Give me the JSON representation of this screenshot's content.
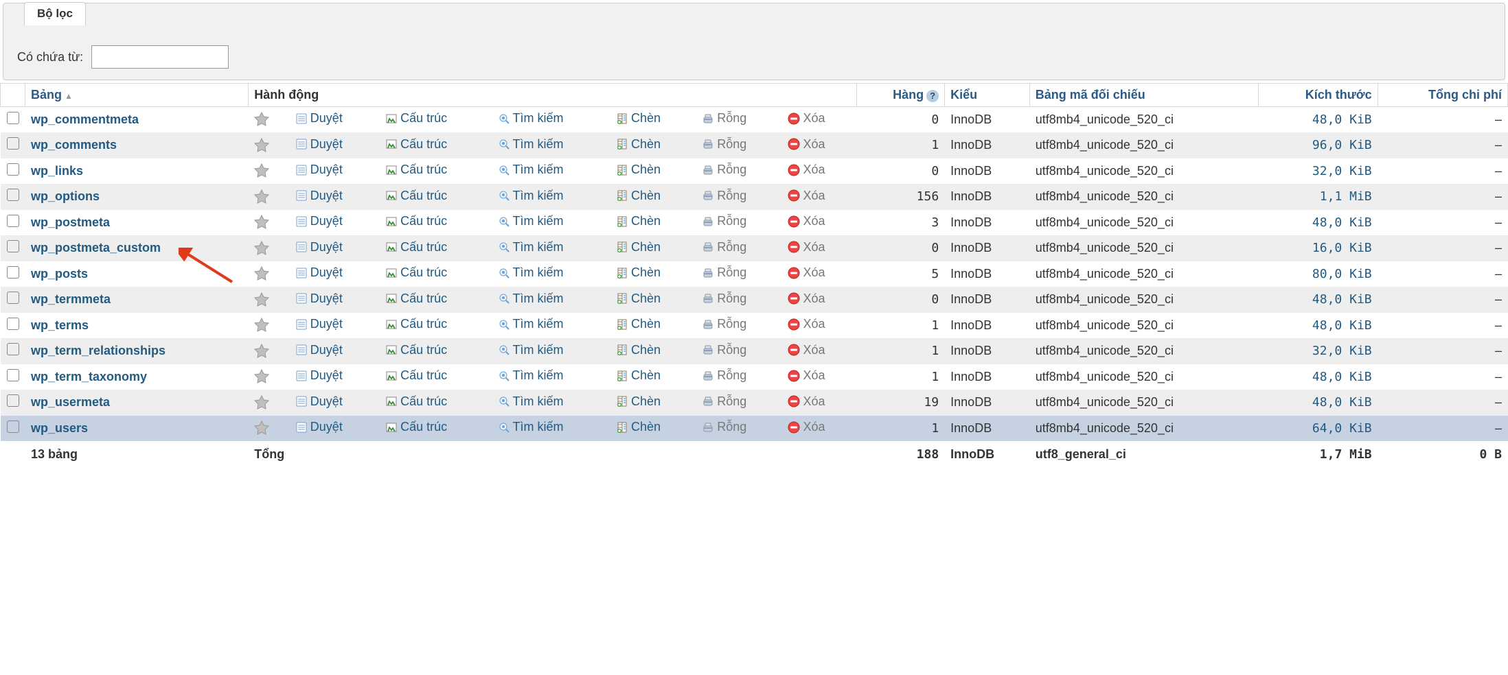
{
  "filter": {
    "tab_label": "Bộ lọc",
    "label": "Có chứa từ:",
    "value": ""
  },
  "columns": {
    "table": "Bảng",
    "action": "Hành động",
    "rows": "Hàng",
    "type": "Kiểu",
    "collation": "Bảng mã đối chiếu",
    "size": "Kích thước",
    "overhead": "Tổng chi phí"
  },
  "action_labels": {
    "browse": "Duyệt",
    "structure": "Cấu trúc",
    "search": "Tìm kiếm",
    "insert": "Chèn",
    "empty": "Rỗng",
    "drop": "Xóa"
  },
  "tables": [
    {
      "name": "wp_commentmeta",
      "rows": "0",
      "type": "InnoDB",
      "collation": "utf8mb4_unicode_520_ci",
      "size": "48,0 KiB",
      "overhead": "–"
    },
    {
      "name": "wp_comments",
      "rows": "1",
      "type": "InnoDB",
      "collation": "utf8mb4_unicode_520_ci",
      "size": "96,0 KiB",
      "overhead": "–"
    },
    {
      "name": "wp_links",
      "rows": "0",
      "type": "InnoDB",
      "collation": "utf8mb4_unicode_520_ci",
      "size": "32,0 KiB",
      "overhead": "–"
    },
    {
      "name": "wp_options",
      "rows": "156",
      "type": "InnoDB",
      "collation": "utf8mb4_unicode_520_ci",
      "size": "1,1 MiB",
      "overhead": "–"
    },
    {
      "name": "wp_postmeta",
      "rows": "3",
      "type": "InnoDB",
      "collation": "utf8mb4_unicode_520_ci",
      "size": "48,0 KiB",
      "overhead": "–"
    },
    {
      "name": "wp_postmeta_custom",
      "rows": "0",
      "type": "InnoDB",
      "collation": "utf8mb4_unicode_520_ci",
      "size": "16,0 KiB",
      "overhead": "–"
    },
    {
      "name": "wp_posts",
      "rows": "5",
      "type": "InnoDB",
      "collation": "utf8mb4_unicode_520_ci",
      "size": "80,0 KiB",
      "overhead": "–"
    },
    {
      "name": "wp_termmeta",
      "rows": "0",
      "type": "InnoDB",
      "collation": "utf8mb4_unicode_520_ci",
      "size": "48,0 KiB",
      "overhead": "–"
    },
    {
      "name": "wp_terms",
      "rows": "1",
      "type": "InnoDB",
      "collation": "utf8mb4_unicode_520_ci",
      "size": "48,0 KiB",
      "overhead": "–"
    },
    {
      "name": "wp_term_relationships",
      "rows": "1",
      "type": "InnoDB",
      "collation": "utf8mb4_unicode_520_ci",
      "size": "32,0 KiB",
      "overhead": "–"
    },
    {
      "name": "wp_term_taxonomy",
      "rows": "1",
      "type": "InnoDB",
      "collation": "utf8mb4_unicode_520_ci",
      "size": "48,0 KiB",
      "overhead": "–"
    },
    {
      "name": "wp_usermeta",
      "rows": "19",
      "type": "InnoDB",
      "collation": "utf8mb4_unicode_520_ci",
      "size": "48,0 KiB",
      "overhead": "–"
    },
    {
      "name": "wp_users",
      "rows": "1",
      "type": "InnoDB",
      "collation": "utf8mb4_unicode_520_ci",
      "size": "64,0 KiB",
      "overhead": "–",
      "hover": true
    }
  ],
  "summary": {
    "count_label": "13 bảng",
    "total_label": "Tổng",
    "rows": "188",
    "type": "InnoDB",
    "collation": "utf8_general_ci",
    "size": "1,7 MiB",
    "overhead": "0 B"
  }
}
